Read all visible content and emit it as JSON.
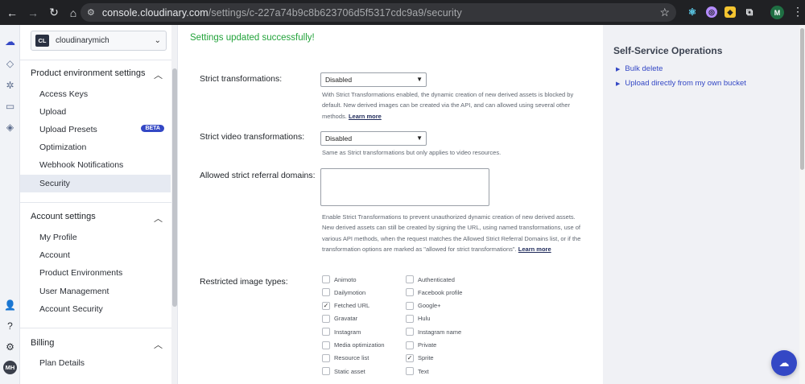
{
  "browser": {
    "url_host": "console.cloudinary.com",
    "url_path": "/settings/c-227a74b9c8b623706d5f5317cdc9a9/security",
    "profile_initial": "M"
  },
  "rail": {
    "user_initials": "MH"
  },
  "sidebar": {
    "environment": {
      "badge": "CL",
      "name": "cloudinarymich"
    },
    "sections": [
      {
        "title": "Product environment settings",
        "items": [
          {
            "label": "Access Keys"
          },
          {
            "label": "Upload"
          },
          {
            "label": "Upload Presets",
            "badge": "BETA"
          },
          {
            "label": "Optimization"
          },
          {
            "label": "Webhook Notifications"
          },
          {
            "label": "Security",
            "active": true
          }
        ]
      },
      {
        "title": "Account settings",
        "items": [
          {
            "label": "My Profile"
          },
          {
            "label": "Account"
          },
          {
            "label": "Product Environments"
          },
          {
            "label": "User Management"
          },
          {
            "label": "Account Security"
          }
        ]
      },
      {
        "title": "Billing",
        "items": [
          {
            "label": "Plan Details"
          }
        ]
      }
    ]
  },
  "main": {
    "success_message": "Settings updated successfully!",
    "strict_transformations": {
      "label": "Strict transformations:",
      "value": "Disabled",
      "help": "With Strict Transformations enabled, the dynamic creation of new derived assets is blocked by default. New derived images can be created via the API, and can allowed using several other methods.",
      "link": "Learn more"
    },
    "strict_video": {
      "label": "Strict video transformations:",
      "value": "Disabled",
      "help": "Same as Strict transformations but only applies to video resources."
    },
    "referral_domains": {
      "label": "Allowed strict referral domains:",
      "value": "",
      "help": "Enable Strict Transformations to prevent unauthorized dynamic creation of new derived assets. New derived assets can still be created by signing the URL, using named transformations, use of various API methods, when the request matches the Allowed Strict Referral Domains list, or if the transformation options are marked as \"allowed for strict transformations\".",
      "link": "Learn more"
    },
    "restricted_types": {
      "label": "Restricted image types:",
      "col1": [
        {
          "label": "Animoto",
          "checked": false
        },
        {
          "label": "Dailymotion",
          "checked": false
        },
        {
          "label": "Fetched URL",
          "checked": true
        },
        {
          "label": "Gravatar",
          "checked": false
        },
        {
          "label": "Instagram",
          "checked": false
        },
        {
          "label": "Media optimization",
          "checked": false
        },
        {
          "label": "Resource list",
          "checked": false
        },
        {
          "label": "Static asset",
          "checked": false
        }
      ],
      "col2": [
        {
          "label": "Authenticated",
          "checked": false
        },
        {
          "label": "Facebook profile",
          "checked": false
        },
        {
          "label": "Google+",
          "checked": false
        },
        {
          "label": "Hulu",
          "checked": false
        },
        {
          "label": "Instagram name",
          "checked": false
        },
        {
          "label": "Private",
          "checked": false
        },
        {
          "label": "Sprite",
          "checked": true
        },
        {
          "label": "Text",
          "checked": false
        }
      ]
    }
  },
  "right_panel": {
    "title": "Self-Service Operations",
    "links": [
      {
        "label": "Bulk delete"
      },
      {
        "label": "Upload directly from my own bucket"
      }
    ]
  },
  "colors": {
    "accent": "#3448c5",
    "success": "#23a33b"
  }
}
